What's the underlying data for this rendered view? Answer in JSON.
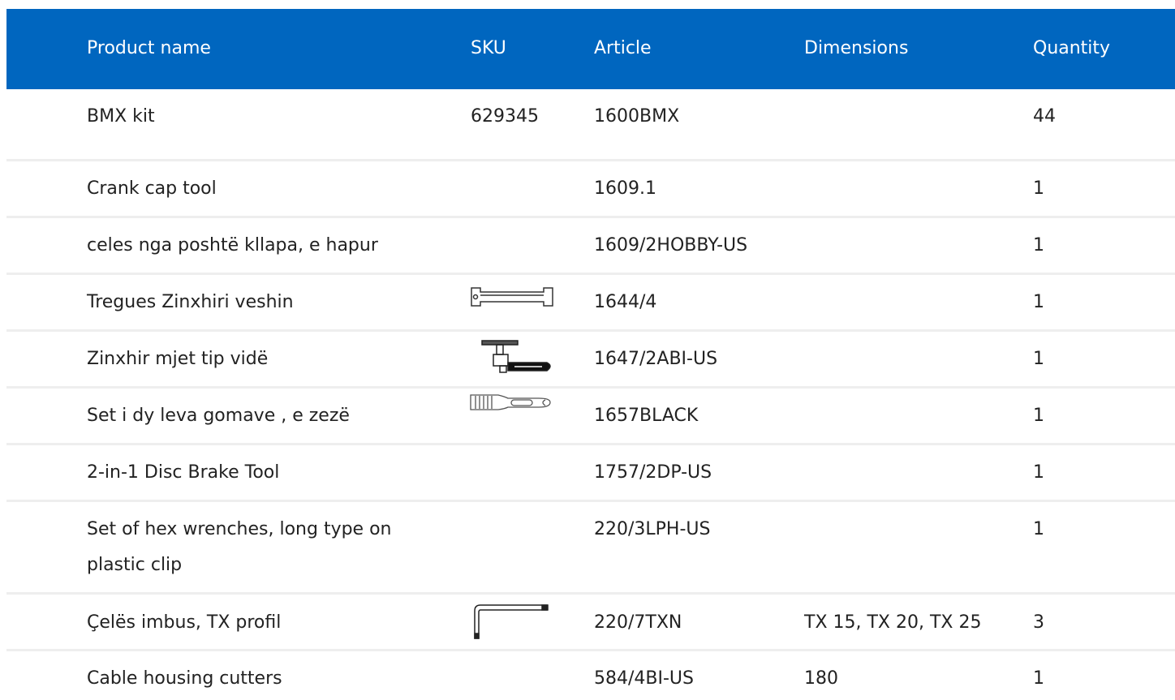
{
  "headers": {
    "name": "Product name",
    "sku": "SKU",
    "article": "Article",
    "dimensions": "Dimensions",
    "quantity": "Quantity"
  },
  "rows": [
    {
      "name": "BMX kit",
      "sku": "629345",
      "article": "1600BMX",
      "dimensions": "",
      "quantity": "44",
      "icon": ""
    },
    {
      "name": "Crank cap tool",
      "sku": "",
      "article": "1609.1",
      "dimensions": "",
      "quantity": "1",
      "icon": ""
    },
    {
      "name": "celes nga poshtë kllapa, e hapur",
      "sku": "",
      "article": "1609/2HOBBY-US",
      "dimensions": "",
      "quantity": "1",
      "icon": ""
    },
    {
      "name": "Tregues Zinxhiri veshin",
      "sku": "",
      "article": "1644/4",
      "dimensions": "",
      "quantity": "1",
      "icon": "chain-wear-indicator-icon"
    },
    {
      "name": "Zinxhir mjet tip vidë",
      "sku": "",
      "article": "1647/2ABI-US",
      "dimensions": "",
      "quantity": "1",
      "icon": "chain-tool-icon"
    },
    {
      "name": "Set i dy leva gomave , e zezë",
      "sku": "",
      "article": "1657BLACK",
      "dimensions": "",
      "quantity": "1",
      "icon": "tire-lever-icon"
    },
    {
      "name": "2-in-1 Disc Brake Tool",
      "sku": "",
      "article": "1757/2DP-US",
      "dimensions": "",
      "quantity": "1",
      "icon": ""
    },
    {
      "name": "Set of hex wrenches, long type on plastic clip",
      "sku": "",
      "article": "220/3LPH-US",
      "dimensions": "",
      "quantity": "1",
      "icon": ""
    },
    {
      "name": "Çelës imbus, TX profil",
      "sku": "",
      "article": "220/7TXN",
      "dimensions": "TX 15, TX 20, TX 25",
      "quantity": "3",
      "icon": "hex-key-icon"
    },
    {
      "name": "Cable housing cutters",
      "sku": "",
      "article": "584/4BI-US",
      "dimensions": "180",
      "quantity": "1",
      "icon": ""
    }
  ]
}
